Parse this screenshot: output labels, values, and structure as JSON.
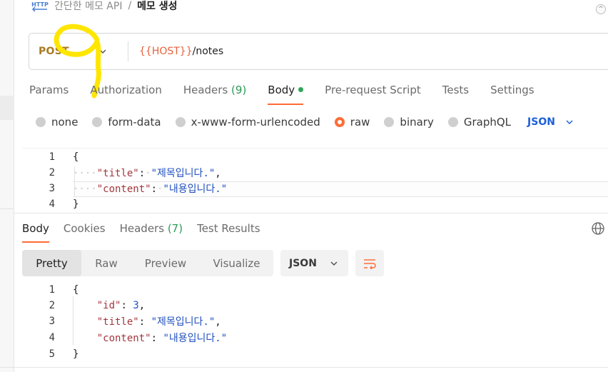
{
  "breadcrumb": {
    "icon_label": "HTTP",
    "parent": "간단한 메모 API",
    "separator": "/",
    "current": "메모 생성"
  },
  "request": {
    "method": "POST",
    "url_variable": "{{HOST}}",
    "url_path": "/notes"
  },
  "request_tabs": [
    {
      "label": "Params"
    },
    {
      "label": "Authorization"
    },
    {
      "label": "Headers",
      "count": "(9)"
    },
    {
      "label": "Body"
    },
    {
      "label": "Pre-request Script"
    },
    {
      "label": "Tests"
    },
    {
      "label": "Settings"
    }
  ],
  "body_types": {
    "options": [
      "none",
      "form-data",
      "x-www-form-urlencoded",
      "raw",
      "binary",
      "GraphQL"
    ],
    "selected": "raw",
    "format": "JSON"
  },
  "request_body": {
    "lines": [
      {
        "num": "1",
        "open": "{"
      },
      {
        "num": "2",
        "key": "\"title\"",
        "value": "\"제목입니다.\"",
        "trail": ","
      },
      {
        "num": "3",
        "key": "\"content\"",
        "value": "\"내용입니다.\"",
        "trail": ""
      },
      {
        "num": "4",
        "close": "}"
      }
    ]
  },
  "response_tabs": [
    {
      "label": "Body"
    },
    {
      "label": "Cookies"
    },
    {
      "label": "Headers",
      "count": "(7)"
    },
    {
      "label": "Test Results"
    }
  ],
  "response_view": {
    "modes": [
      "Pretty",
      "Raw",
      "Preview",
      "Visualize"
    ],
    "selected": "Pretty",
    "format": "JSON"
  },
  "response_body": {
    "lines": [
      {
        "num": "1",
        "text": "{"
      },
      {
        "num": "2",
        "key": "\"id\"",
        "value": "3",
        "trail": ","
      },
      {
        "num": "3",
        "key": "\"title\"",
        "value": "\"제목입니다.\"",
        "trail": ","
      },
      {
        "num": "4",
        "key": "\"content\"",
        "value": "\"내용입니다.\"",
        "trail": ""
      },
      {
        "num": "5",
        "text": "}"
      }
    ]
  },
  "colors": {
    "accent": "#ff6c37",
    "method": "#a97b22",
    "variable": "#e8613b",
    "json_key": "#a3363d",
    "json_string": "#1f4fbf",
    "count": "#2e9a56",
    "annotation": "#ffe600"
  }
}
